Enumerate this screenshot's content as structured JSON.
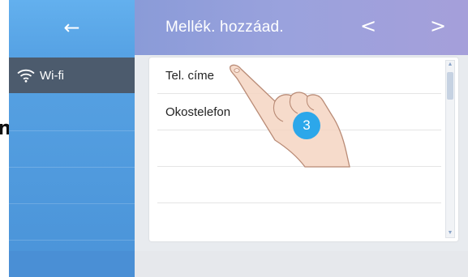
{
  "header": {
    "title": "Mellék. hozzáad.",
    "back_icon": "←",
    "prev_icon": "<",
    "next_icon": ">"
  },
  "edge_fragment": "n",
  "sidebar": {
    "items": [
      {
        "label": "Wi-fi",
        "icon": "wifi-icon",
        "active": true
      },
      {
        "label": ""
      },
      {
        "label": ""
      },
      {
        "label": ""
      },
      {
        "label": ""
      }
    ]
  },
  "list": {
    "rows": [
      {
        "label": "Tel. címe"
      },
      {
        "label": "Okostelefon"
      },
      {
        "label": ""
      },
      {
        "label": ""
      },
      {
        "label": ""
      }
    ]
  },
  "tutorial": {
    "step": "3"
  },
  "colors": {
    "sidebar": "#4a93d8",
    "header": "#9aa2dd",
    "active_item": "#4c5b6d",
    "badge": "#2ca7ea"
  }
}
